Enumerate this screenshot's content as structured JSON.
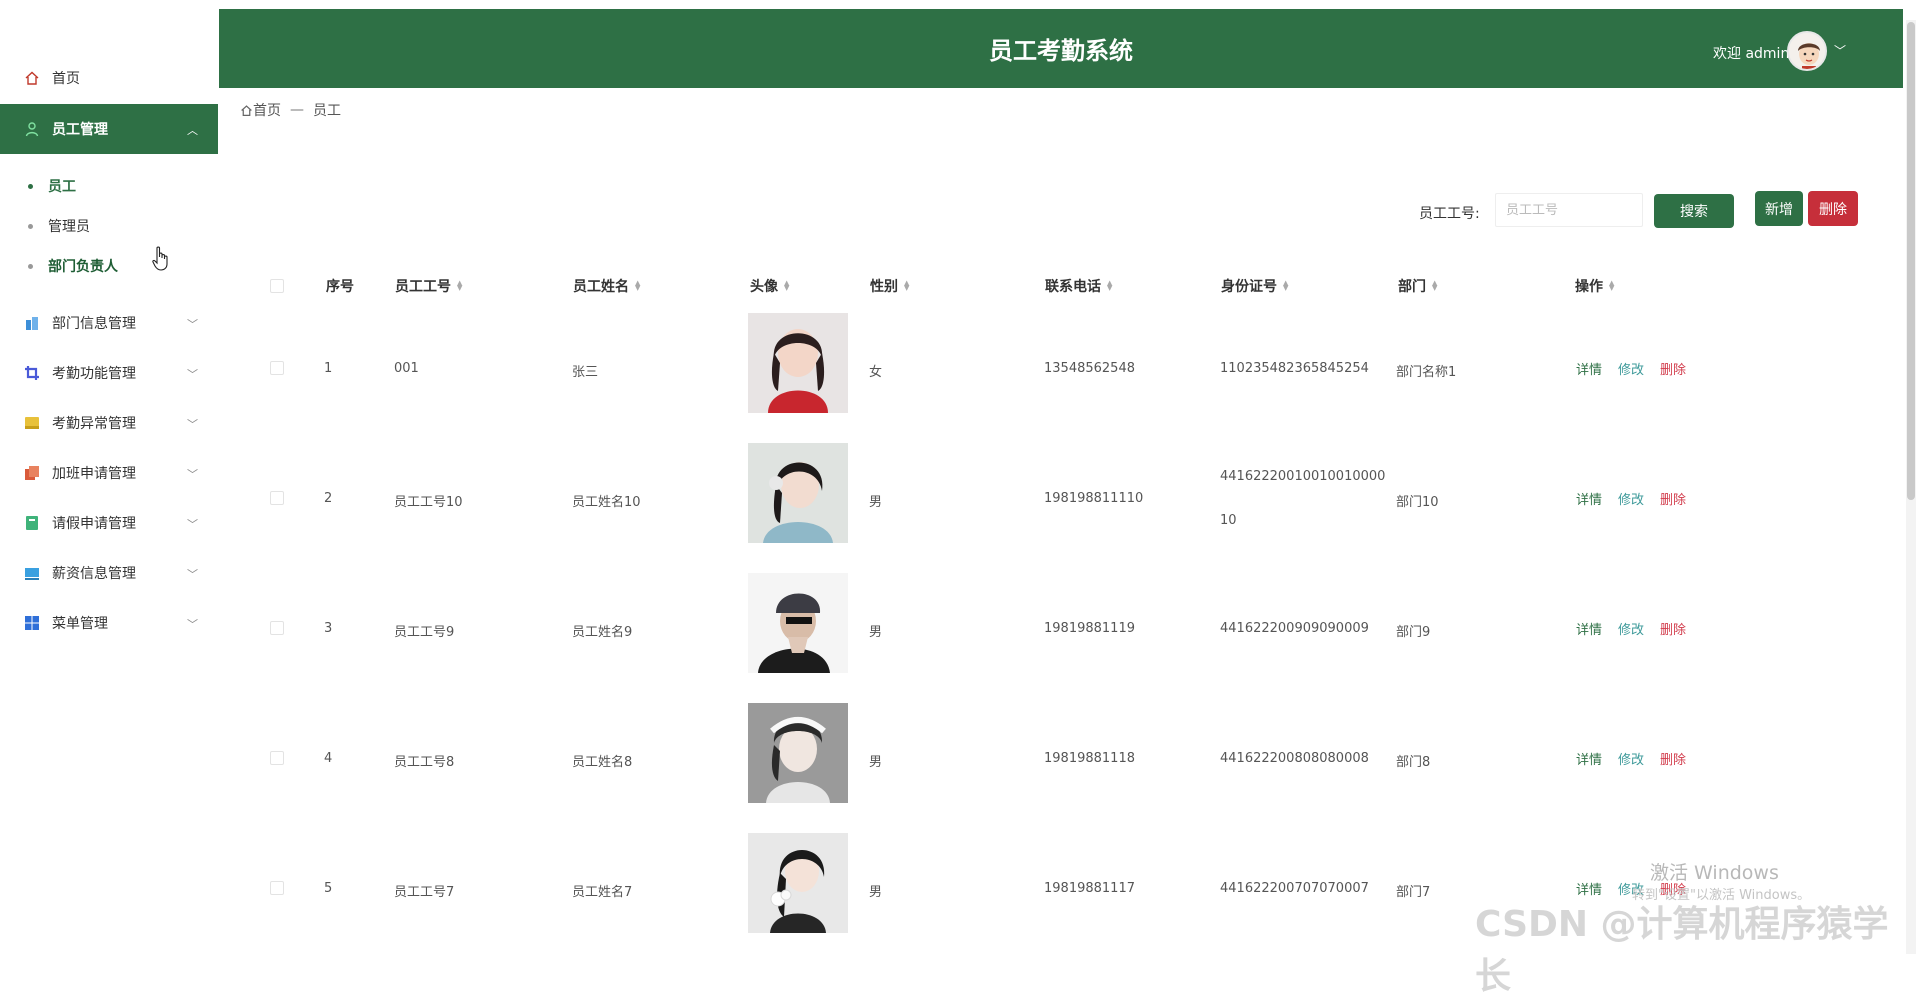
{
  "sidebar": {
    "home": "首页",
    "employee_mgmt": "员工管理",
    "sub_items": [
      "员工",
      "管理员",
      "部门负责人"
    ],
    "groups": [
      "部门信息管理",
      "考勤功能管理",
      "考勤异常管理",
      "加班申请管理",
      "请假申请管理",
      "薪资信息管理",
      "菜单管理"
    ]
  },
  "header": {
    "title": "员工考勤系统",
    "welcome": "欢迎 admin"
  },
  "breadcrumb": {
    "home": "首页",
    "separator": "—",
    "current": "员工"
  },
  "search": {
    "label": "员工工号:",
    "placeholder": "员工工号",
    "search_button": "搜索",
    "add_button": "新增",
    "delete_button": "删除"
  },
  "table": {
    "columns": [
      "序号",
      "员工工号",
      "员工姓名",
      "头像",
      "性别",
      "联系电话",
      "身份证号",
      "部门",
      "操作"
    ],
    "actions": {
      "detail": "详情",
      "edit": "修改",
      "delete": "删除"
    },
    "rows": [
      {
        "index": "1",
        "emp_no": "001",
        "name": "张三",
        "gender": "女",
        "phone": "13548562548",
        "id_card": "110235482365845254",
        "dept": "部门名称1"
      },
      {
        "index": "2",
        "emp_no": "员工工号10",
        "name": "员工姓名10",
        "gender": "男",
        "phone": "198198811110",
        "id_card": "44162220010010010000",
        "id_card_2": "10",
        "dept": "部门10"
      },
      {
        "index": "3",
        "emp_no": "员工工号9",
        "name": "员工姓名9",
        "gender": "男",
        "phone": "19819881119",
        "id_card": "441622200909090009",
        "dept": "部门9"
      },
      {
        "index": "4",
        "emp_no": "员工工号8",
        "name": "员工姓名8",
        "gender": "男",
        "phone": "19819881118",
        "id_card": "441622200808080008",
        "dept": "部门8"
      },
      {
        "index": "5",
        "emp_no": "员工工号7",
        "name": "员工姓名7",
        "gender": "男",
        "phone": "19819881117",
        "id_card": "441622200707070007",
        "dept": "部门7"
      }
    ]
  },
  "watermarks": {
    "windows_title": "激活 Windows",
    "windows_sub": "转到\"设置\"以激活 Windows。",
    "csdn": "CSDN @计算机程序猿学长"
  },
  "colors": {
    "primary": "#2e7045",
    "danger": "#c62f3a",
    "edit": "#3d9a9a"
  }
}
